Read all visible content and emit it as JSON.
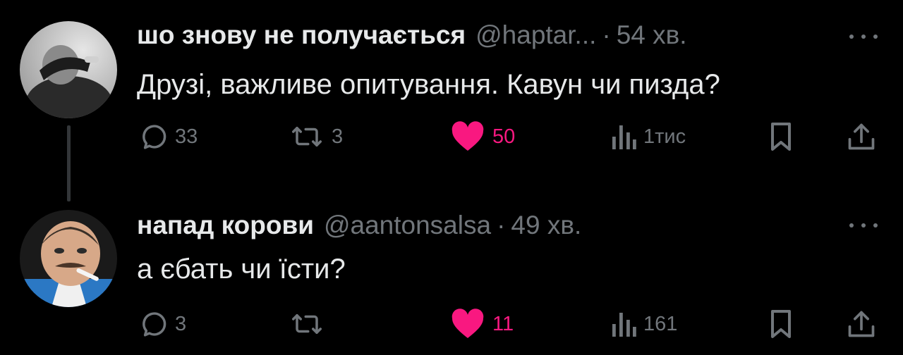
{
  "colors": {
    "background": "#000000",
    "text_primary": "#e7e9ea",
    "text_secondary": "#71767b",
    "like_active": "#f91880",
    "thread_line": "#333639"
  },
  "posts": [
    {
      "display_name": "шо знову не получається",
      "handle": "@haptar...",
      "separator": "·",
      "time": "54 хв.",
      "text": "Друзі, важливе опитування. Кавун чи пизда?",
      "avatar_icon": "avatar-photo",
      "actions": {
        "reply": {
          "icon": "reply-icon",
          "count": "33"
        },
        "repost": {
          "icon": "repost-icon",
          "count": "3"
        },
        "like": {
          "icon": "heart-filled-icon",
          "count": "50",
          "liked": true
        },
        "views": {
          "icon": "views-icon",
          "count": "1тис"
        },
        "bookmark": {
          "icon": "bookmark-icon"
        },
        "share": {
          "icon": "share-icon"
        }
      }
    },
    {
      "display_name": "напад корови",
      "handle": "@aantonsalsa",
      "separator": "·",
      "time": "49 хв.",
      "text": "а єбать чи їсти?",
      "avatar_icon": "avatar-photo",
      "actions": {
        "reply": {
          "icon": "reply-icon",
          "count": "3"
        },
        "repost": {
          "icon": "repost-icon",
          "count": ""
        },
        "like": {
          "icon": "heart-filled-icon",
          "count": "11",
          "liked": true
        },
        "views": {
          "icon": "views-icon",
          "count": "161"
        },
        "bookmark": {
          "icon": "bookmark-icon"
        },
        "share": {
          "icon": "share-icon"
        }
      }
    }
  ]
}
